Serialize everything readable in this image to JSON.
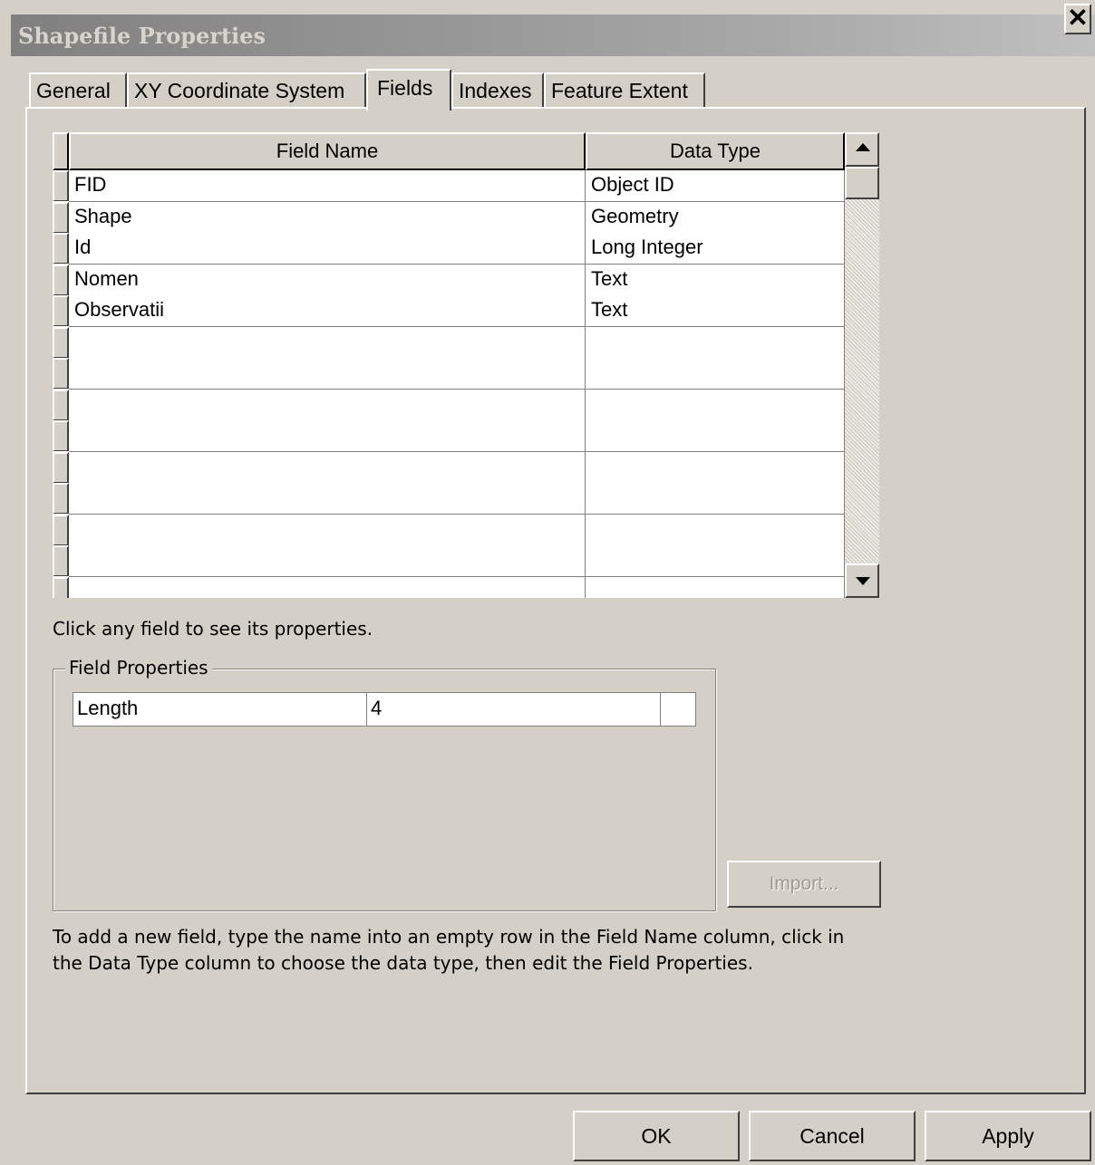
{
  "window": {
    "title": "Shapefile Properties",
    "close_glyph": "✕"
  },
  "tabs": [
    {
      "label": "General",
      "active": false
    },
    {
      "label": "XY Coordinate System",
      "active": false
    },
    {
      "label": "Fields",
      "active": true
    },
    {
      "label": "Indexes",
      "active": false
    },
    {
      "label": "Feature Extent",
      "active": false
    }
  ],
  "fields_grid": {
    "columns": [
      "Field Name",
      "Data Type"
    ],
    "rows": [
      {
        "name": "FID",
        "type": "Object ID"
      },
      {
        "name": "Shape",
        "type": "Geometry"
      },
      {
        "name": "Id",
        "type": "Long Integer"
      },
      {
        "name": "Nomen",
        "type": "Text"
      },
      {
        "name": "Observatii",
        "type": "Text"
      },
      {
        "name": "",
        "type": ""
      },
      {
        "name": "",
        "type": ""
      },
      {
        "name": "",
        "type": ""
      },
      {
        "name": "",
        "type": ""
      },
      {
        "name": "",
        "type": ""
      },
      {
        "name": "",
        "type": ""
      },
      {
        "name": "",
        "type": ""
      },
      {
        "name": "",
        "type": ""
      },
      {
        "name": "",
        "type": ""
      }
    ]
  },
  "hint_text": "Click any field to see its properties.",
  "field_properties": {
    "legend": "Field Properties",
    "property_name": "Length",
    "property_value": "4",
    "import_label": "Import..."
  },
  "instructions": [
    "To add a new field, type the name into an empty row in the Field Name column, click in",
    "the Data Type column to choose the data type, then edit the Field Properties."
  ],
  "buttons": {
    "ok": "OK",
    "cancel": "Cancel",
    "apply": "Apply"
  },
  "colors": {
    "dialog_bg": "#d4d0c8",
    "titlebar_inactive": "#808080",
    "disabled_text": "#a09c94"
  }
}
